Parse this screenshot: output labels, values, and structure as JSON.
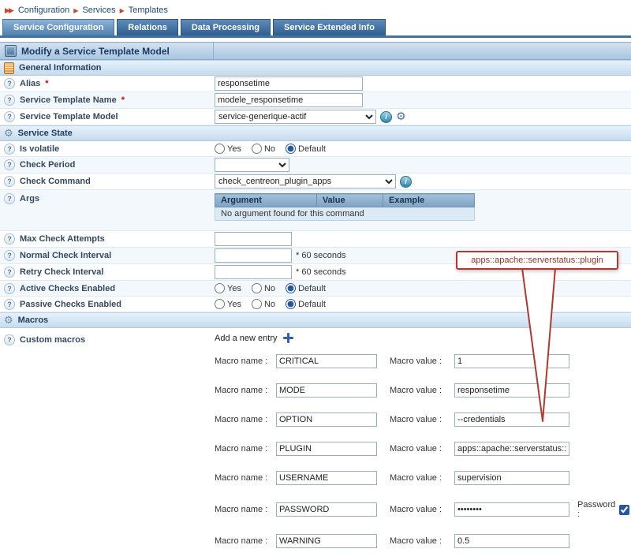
{
  "breadcrumb": {
    "items": {
      "a": "Configuration",
      "b": "Services",
      "c": "Templates"
    }
  },
  "tabs": {
    "service_configuration": "Service Configuration",
    "relations": "Relations",
    "data_processing": "Data Processing",
    "service_extended_info": "Service Extended Info"
  },
  "page": {
    "title": "Modify a Service Template Model"
  },
  "sections": {
    "general_information": "General Information",
    "service_state": "Service State",
    "macros": "Macros"
  },
  "labels": {
    "alias": "Alias",
    "service_template_name": "Service Template Name",
    "service_template_model": "Service Template Model",
    "is_volatile": "Is volatile",
    "check_period": "Check Period",
    "check_command": "Check Command",
    "args": "Args",
    "max_check_attempts": "Max Check Attempts",
    "normal_check_interval": "Normal Check Interval",
    "retry_check_interval": "Retry Check Interval",
    "active_checks_enabled": "Active Checks Enabled",
    "passive_checks_enabled": "Passive Checks Enabled",
    "custom_macros": "Custom macros",
    "required_marker": "*",
    "seconds_suffix": "* 60 seconds",
    "yes": "Yes",
    "no": "No",
    "default": "Default",
    "add_new_entry": "Add a new entry",
    "macro_name": "Macro name :",
    "macro_value": "Macro value :",
    "password_label": "Password :"
  },
  "values": {
    "alias": "responsetime",
    "service_template_name": "modele_responsetime",
    "service_template_model": "service-generique-actif",
    "check_period": "",
    "check_command": "check_centreon_plugin_apps",
    "max_check_attempts": "",
    "normal_check_interval": "",
    "retry_check_interval": ""
  },
  "state": {
    "is_volatile": "Default",
    "active_checks_enabled": "Default",
    "passive_checks_enabled": "Default",
    "password_checkbox": "checked"
  },
  "args_table": {
    "headers": {
      "argument": "Argument",
      "value": "Value",
      "example": "Example"
    },
    "empty_text": "No argument found for this command"
  },
  "macros": {
    "rows": [
      {
        "name": "CRITICAL",
        "value": "1"
      },
      {
        "name": "MODE",
        "value": "responsetime"
      },
      {
        "name": "OPTION",
        "value": "--credentials"
      },
      {
        "name": "PLUGIN",
        "value": "apps::apache::serverstatus::"
      },
      {
        "name": "USERNAME",
        "value": "supervision"
      },
      {
        "name": "PASSWORD",
        "value": "********"
      },
      {
        "name": "WARNING",
        "value": "0.5"
      }
    ]
  },
  "callout": {
    "text": "apps::apache::serverstatus::plugin"
  },
  "colors": {
    "tab_blue": "#2f5d8e",
    "accent": "#2457a0",
    "callout_red": "#b0392e"
  }
}
